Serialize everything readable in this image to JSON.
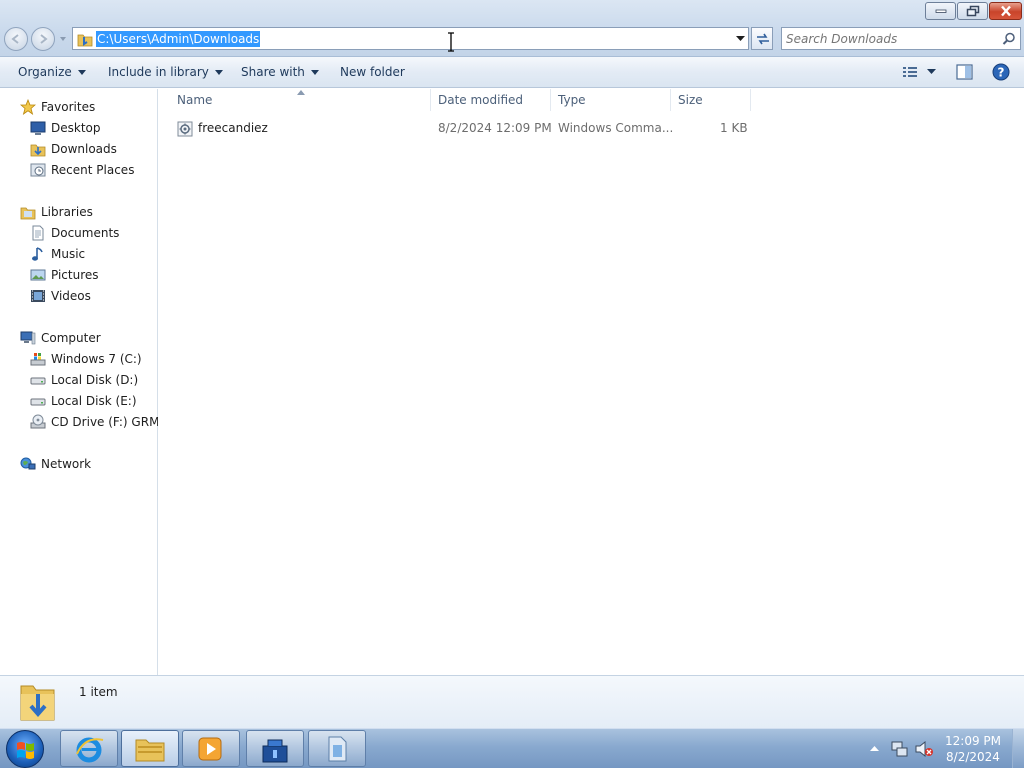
{
  "window": {
    "address_path": "C:\\Users\\Admin\\Downloads",
    "search_placeholder": "Search Downloads"
  },
  "toolbar": {
    "organize": "Organize",
    "include_in_library": "Include in library",
    "share_with": "Share with",
    "new_folder": "New folder"
  },
  "nav": {
    "favorites": {
      "label": "Favorites",
      "items": [
        "Desktop",
        "Downloads",
        "Recent Places"
      ]
    },
    "libraries": {
      "label": "Libraries",
      "items": [
        "Documents",
        "Music",
        "Pictures",
        "Videos"
      ]
    },
    "computer": {
      "label": "Computer",
      "items": [
        "Windows 7 (C:)",
        "Local Disk (D:)",
        "Local Disk (E:)",
        "CD Drive (F:) GRMSXFREO"
      ]
    },
    "network": {
      "label": "Network"
    }
  },
  "columns": {
    "name": "Name",
    "date_modified": "Date modified",
    "type": "Type",
    "size": "Size"
  },
  "files": [
    {
      "name": "freecandiez",
      "date_modified": "8/2/2024 12:09 PM",
      "type": "Windows Comma...",
      "size": "1 KB"
    }
  ],
  "details": {
    "item_count": "1 item"
  },
  "taskbar": {
    "time": "12:09 PM",
    "date": "8/2/2024"
  },
  "colors": {
    "selection": "#3399ff",
    "toolbar_text": "#1e395b",
    "taskbar": "#89a9cf"
  }
}
